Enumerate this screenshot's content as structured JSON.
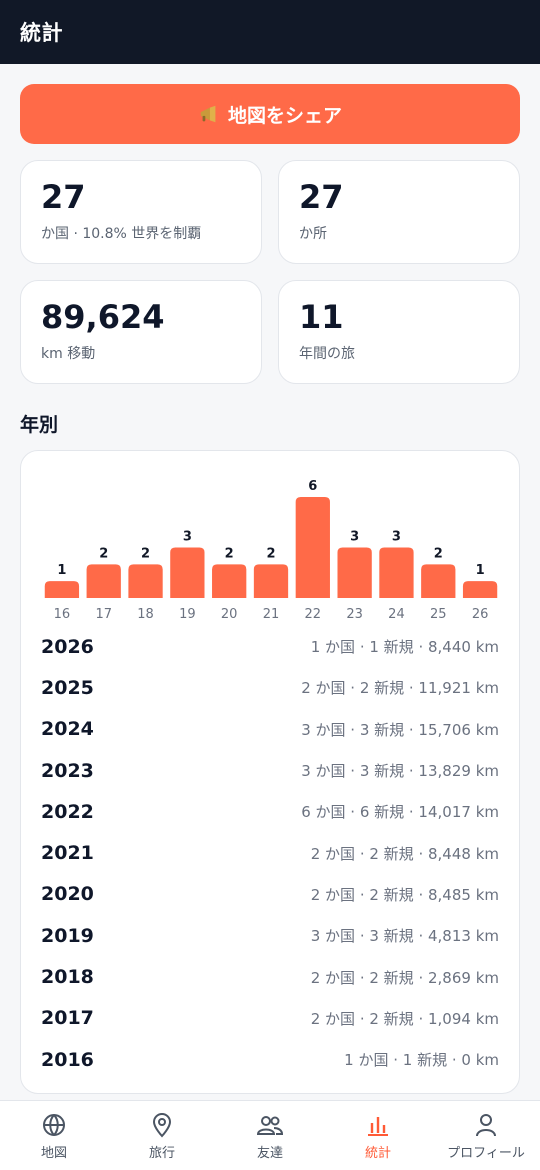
{
  "header": {
    "title": "統計"
  },
  "share_button": {
    "label": "地図をシェア",
    "icon": "megaphone-icon"
  },
  "stats": [
    {
      "value": "27",
      "label": "か国 · 10.8% 世界を制覇"
    },
    {
      "value": "27",
      "label": "か所"
    },
    {
      "value": "89,624",
      "label": "km 移動"
    },
    {
      "value": "11",
      "label": "年間の旅"
    }
  ],
  "yearly": {
    "title": "年別",
    "rows": [
      {
        "year": "2026",
        "detail": "1 か国 · 1 新規 · 8,440 km"
      },
      {
        "year": "2025",
        "detail": "2 か国 · 2 新規 · 11,921 km"
      },
      {
        "year": "2024",
        "detail": "3 か国 · 3 新規 · 15,706 km"
      },
      {
        "year": "2023",
        "detail": "3 か国 · 3 新規 · 13,829 km"
      },
      {
        "year": "2022",
        "detail": "6 か国 · 6 新規 · 14,017 km"
      },
      {
        "year": "2021",
        "detail": "2 か国 · 2 新規 · 8,448 km"
      },
      {
        "year": "2020",
        "detail": "2 か国 · 2 新規 · 8,485 km"
      },
      {
        "year": "2019",
        "detail": "3 か国 · 3 新規 · 4,813 km"
      },
      {
        "year": "2018",
        "detail": "2 か国 · 2 新規 · 2,869 km"
      },
      {
        "year": "2017",
        "detail": "2 か国 · 2 新規 · 1,094 km"
      },
      {
        "year": "2016",
        "detail": "1 か国 · 1 新規 · 0 km"
      }
    ]
  },
  "chart_data": {
    "type": "bar",
    "categories": [
      "16",
      "17",
      "18",
      "19",
      "20",
      "21",
      "22",
      "23",
      "24",
      "25",
      "26"
    ],
    "values": [
      1,
      2,
      2,
      3,
      2,
      2,
      6,
      3,
      3,
      2,
      1
    ],
    "ylim": [
      0,
      6
    ],
    "bar_color": "#ff6a48",
    "grid": false
  },
  "tabs": [
    {
      "label": "地図",
      "icon": "globe-icon",
      "active": false
    },
    {
      "label": "旅行",
      "icon": "map-pin-icon",
      "active": false
    },
    {
      "label": "友達",
      "icon": "friends-icon",
      "active": false
    },
    {
      "label": "統計",
      "icon": "bar-chart-icon",
      "active": true
    },
    {
      "label": "プロフィール",
      "icon": "person-icon",
      "active": false
    }
  ],
  "colors": {
    "accent": "#ff6a48",
    "header_bg": "#111827",
    "active_tab": "#ff5a36"
  }
}
